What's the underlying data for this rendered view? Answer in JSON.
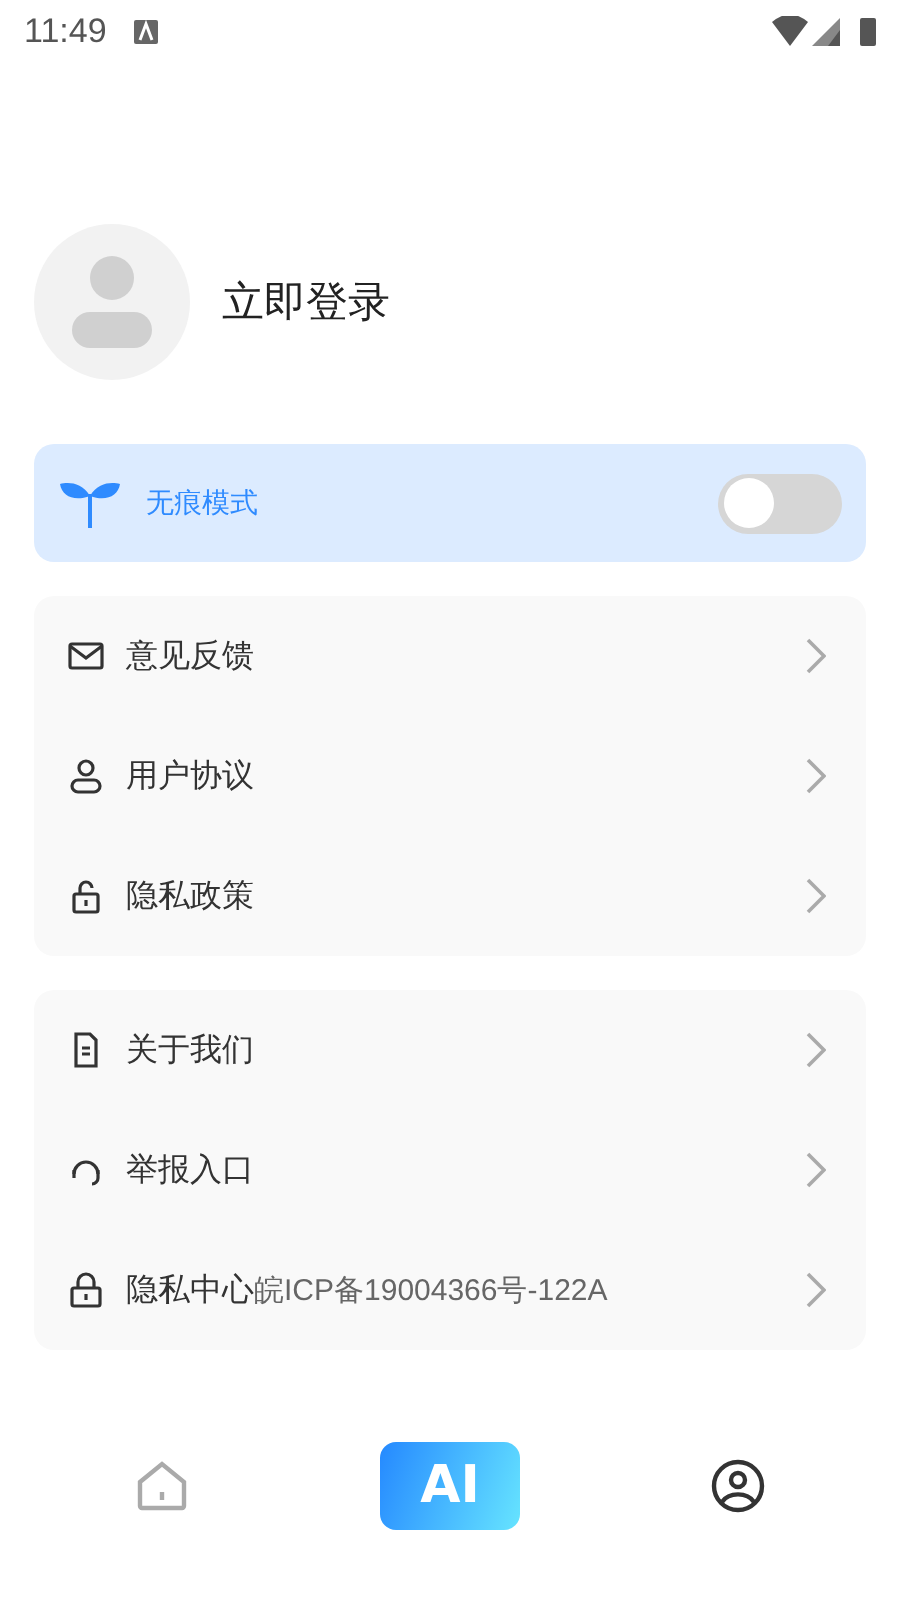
{
  "status_bar": {
    "time": "11:49"
  },
  "profile": {
    "login_label": "立即登录"
  },
  "incognito": {
    "label": "无痕模式",
    "on": false
  },
  "menu_groups": [
    {
      "items": [
        {
          "kind": "mail",
          "label": "意见反馈"
        },
        {
          "kind": "user",
          "label": "用户协议"
        },
        {
          "kind": "unlock",
          "label": "隐私政策"
        }
      ]
    },
    {
      "items": [
        {
          "kind": "document",
          "label": "关于我们"
        },
        {
          "kind": "headset",
          "label": "举报入口"
        },
        {
          "kind": "lock",
          "label": "隐私中心",
          "note": "皖ICP备19004366号-122A"
        }
      ]
    }
  ],
  "bottom_nav": [
    {
      "kind": "home",
      "selected": false
    },
    {
      "kind": "ai",
      "label": "AI",
      "selected": false
    },
    {
      "kind": "profile",
      "selected": true
    }
  ]
}
